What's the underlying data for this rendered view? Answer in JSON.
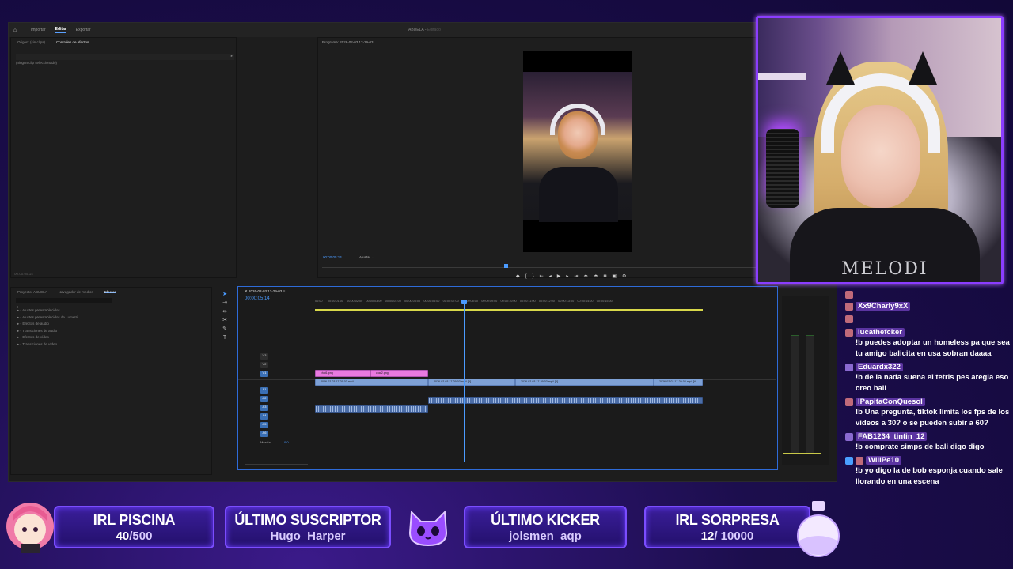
{
  "premiere": {
    "workspace_tabs": [
      "Importar",
      "Editar",
      "Exportar"
    ],
    "active_tab": "Editar",
    "doc_title": "ABUELA",
    "doc_subtitle": "Editado",
    "source_tabs": [
      "Origen: (sin clips)",
      "Controles de efectos"
    ],
    "no_clip_text": "(ningún clip seleccionado)",
    "source_timecode": "00:00:05:14",
    "program_title": "Programa: 2026-02-03 17-29-03",
    "program_timecode": "00:00:05:14",
    "fit_label": "Ajustar",
    "project_tabs": [
      "Proyecto: ABUELA",
      "Navegador de medios",
      "Efectos"
    ],
    "effects_tree": [
      "Ajustes preestablecidos",
      "Ajustes preestablecidos de Lumetri",
      "Efectos de audio",
      "Transiciones de audio",
      "Efectos de vídeo",
      "Transiciones de vídeo"
    ],
    "timeline": {
      "sequence_name": "2026-02-03 17-29-03",
      "timecode": "00:00:05:14",
      "ruler": [
        "00:00",
        "00:00:01:00",
        "00:00:02:00",
        "00:00:03:00",
        "00:00:04:00",
        "00:00:05:00",
        "00:00:06:00",
        "00:00:07:00",
        "00:00:08:00",
        "00:00:09:00",
        "00:00:10:00",
        "00:00:11:00",
        "00:00:12:00",
        "00:00:13:00",
        "00:00:14:00",
        "00:00:15:00",
        "00:00:16:00"
      ],
      "video_tracks": [
        "V3",
        "V2",
        "V1"
      ],
      "audio_tracks": [
        "A1",
        "A2",
        "A3",
        "A4",
        "A5",
        "A6"
      ],
      "mix_label": "Mezcla",
      "mix_value": "0,0",
      "pink_clips": [
        "chat1.png",
        "chat2.png"
      ],
      "blue_clips": [
        "2026-02-03 17-29-03.mp4",
        "2026-02-03 17-29-03.mp4 [V]",
        "2026-02-03 17-29-03.mp4 [V]",
        "2026-02-03 17-29-03.mp4 [V]"
      ]
    }
  },
  "chat": {
    "messages": [
      {
        "user": "",
        "text": "",
        "badge_color": "#c06a7a"
      },
      {
        "user": "Xx9Charly9xX",
        "text": "",
        "badge_color": "#c06a7a"
      },
      {
        "user": "",
        "text": "",
        "badge_color": "#c06a7a"
      },
      {
        "user": "lucathefcker",
        "text": "!b puedes adoptar un homeless pa que sea tu amigo balicita en usa sobran daaaa",
        "badge_color": "#c06a7a"
      },
      {
        "user": "Eduardx322",
        "text": "!b de la nada suena el tetris pes aregla eso creo bali",
        "badge_color": "#8a6ad0"
      },
      {
        "user": "lPapitaConQuesol",
        "text": "!b Una pregunta, tiktok limita los fps de los videos a 30? o se pueden subir a 60?",
        "badge_color": "#c06a7a"
      },
      {
        "user": "FAB1234_tintin_12",
        "text": "!b comprate simps de bali digo digo",
        "badge_color": "#8a6ad0"
      },
      {
        "user": "WillPe10",
        "text": "!b yo digo la de bob esponja cuando sale llorando en una escena",
        "badge_color": "#4aa0ff"
      }
    ]
  },
  "goals": {
    "pool": {
      "title": "IRL PISCINA",
      "current": "40",
      "target": "/500"
    },
    "subscriber": {
      "title": "ÚLTIMO SUSCRIPTOR",
      "name": "Hugo_Harper"
    },
    "kicker": {
      "title": "ÚLTIMO KICKER",
      "name": "jolsmen_aqp"
    },
    "surprise": {
      "title": "IRL SORPRESA",
      "current": "12",
      "target": "/ 10000"
    }
  },
  "webcam": {
    "shirt_text": "MELODI"
  },
  "colors": {
    "accent": "#8b3dff",
    "timeline_border": "#2e6bd8",
    "playhead": "#4b9bff",
    "pink_clip": "#e87ae0",
    "blue_clip": "#7ea1d6"
  }
}
